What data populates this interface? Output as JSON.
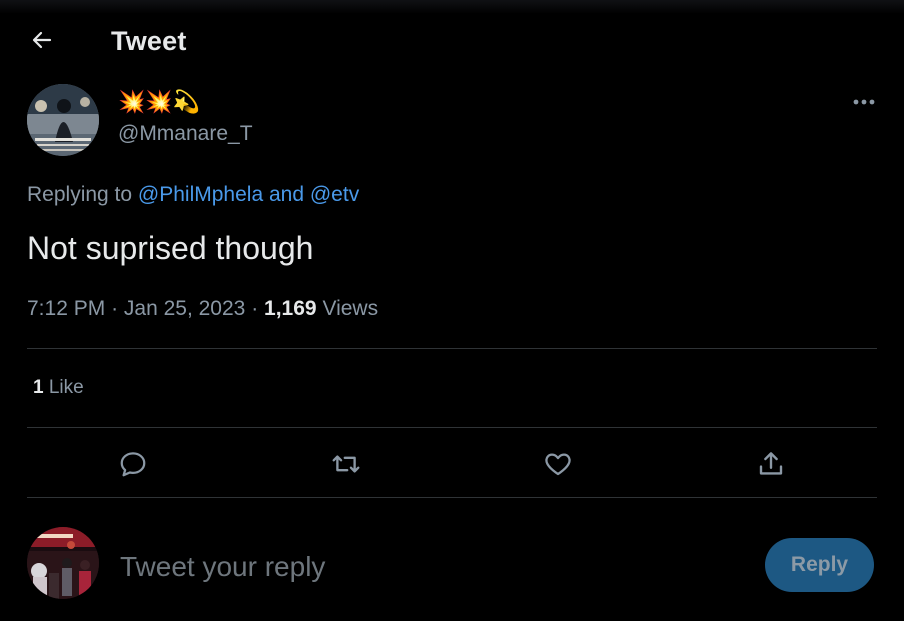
{
  "header": {
    "title": "Tweet"
  },
  "tweet": {
    "display_name": "💥💥💫",
    "handle": "@Mmanare_T",
    "replying_prefix": "Replying to",
    "replying_user1": "@PhilMphela",
    "replying_and": "and",
    "replying_user2": "@etv",
    "text": "Not suprised though",
    "time": "7:12 PM",
    "sep": "·",
    "date": "Jan 25, 2023",
    "views_count": "1,169",
    "views_label": "Views",
    "likes_count": "1",
    "likes_label": "Like"
  },
  "reply": {
    "placeholder": "Tweet your reply",
    "button_label": "Reply"
  },
  "colors": {
    "accent": "#1d9bf0",
    "link": "#4a99e9",
    "muted": "#8b98a5",
    "reply_button_bg": "#1d5883"
  }
}
